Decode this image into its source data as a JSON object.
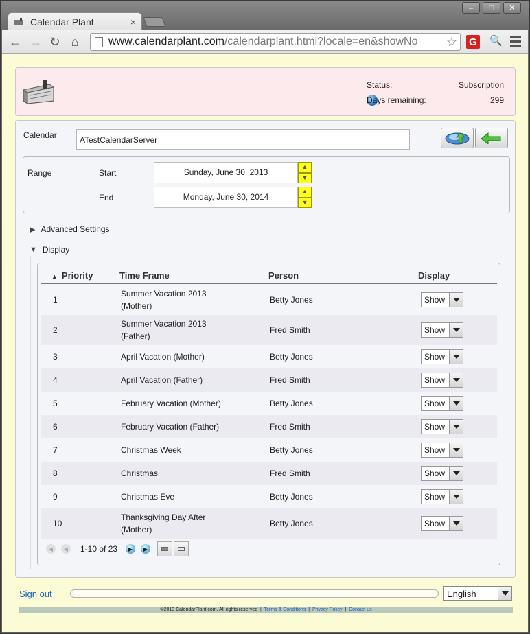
{
  "browser": {
    "tab_title": "Calendar Plant",
    "tab_close": "×",
    "url_host": "www.calendarplant.com",
    "url_rest": "/calendarplant.html?locale=en&showNo",
    "ext_letter": "G"
  },
  "header": {
    "status_label": "Status:",
    "status_value": "Subscription",
    "days_label": "Days remaining:",
    "days_value": "299"
  },
  "calendar": {
    "label": "Calendar",
    "value": "ATestCalendarServer"
  },
  "range": {
    "label": "Range",
    "start_label": "Start",
    "start_value": "Sunday, June 30, 2013",
    "end_label": "End",
    "end_value": "Monday, June 30, 2014"
  },
  "sections": {
    "advanced": "Advanced Settings",
    "display": "Display"
  },
  "table": {
    "headers": {
      "priority": "Priority",
      "time_frame": "Time Frame",
      "person": "Person",
      "display": "Display"
    },
    "rows": [
      {
        "priority": "1",
        "time_frame": "Summer Vacation 2013 (Mother)",
        "person": "Betty Jones",
        "display": "Show"
      },
      {
        "priority": "2",
        "time_frame": "Summer Vacation 2013 (Father)",
        "person": "Fred Smith",
        "display": "Show"
      },
      {
        "priority": "3",
        "time_frame": "April Vacation (Mother)",
        "person": "Betty Jones",
        "display": "Show"
      },
      {
        "priority": "4",
        "time_frame": "April Vacation (Father)",
        "person": "Fred Smith",
        "display": "Show"
      },
      {
        "priority": "5",
        "time_frame": "February Vacation (Mother)",
        "person": "Betty Jones",
        "display": "Show"
      },
      {
        "priority": "6",
        "time_frame": "February Vacation (Father)",
        "person": "Fred Smith",
        "display": "Show"
      },
      {
        "priority": "7",
        "time_frame": "Christmas Week",
        "person": "Betty Jones",
        "display": "Show"
      },
      {
        "priority": "8",
        "time_frame": "Christmas",
        "person": "Fred Smith",
        "display": "Show"
      },
      {
        "priority": "9",
        "time_frame": "Christmas Eve",
        "person": "Betty Jones",
        "display": "Show"
      },
      {
        "priority": "10",
        "time_frame": "Thanksgiving Day After (Mother)",
        "person": "Betty Jones",
        "display": "Show"
      }
    ],
    "pager_text": "1-10 of 23"
  },
  "footer": {
    "signout": "Sign out",
    "language": "English",
    "copyright": "©2013 CalendarPlant.com. All rights reserved",
    "terms": "Terms & Conditions",
    "privacy": "Privacy Policy",
    "contact": "Contact us"
  }
}
